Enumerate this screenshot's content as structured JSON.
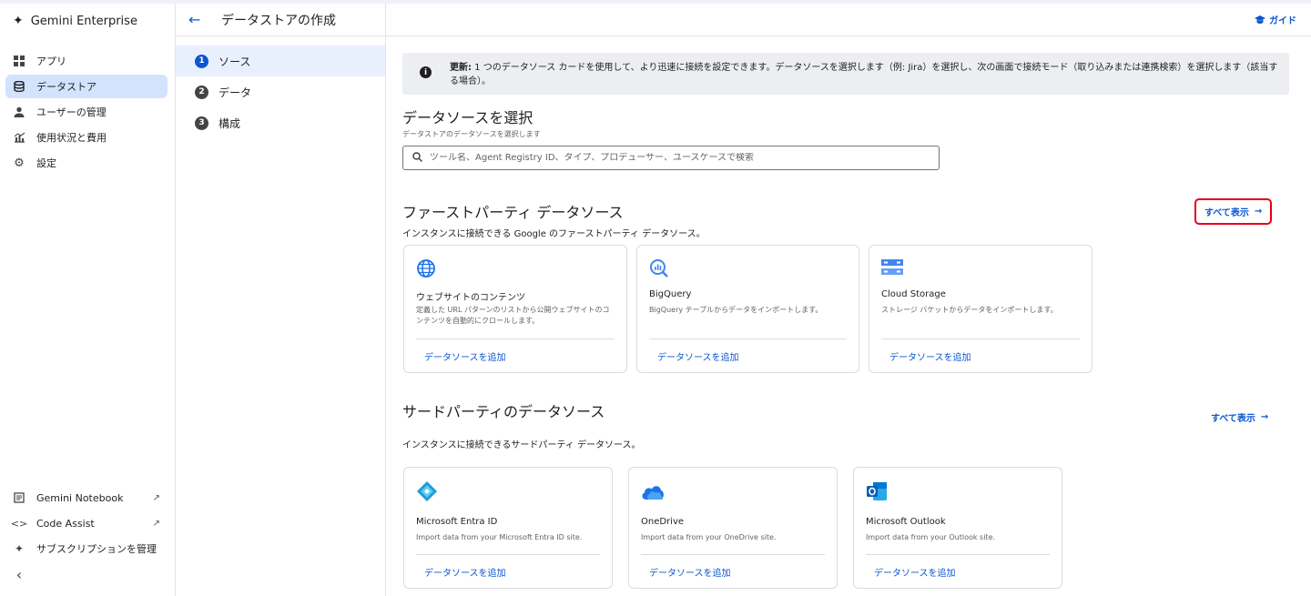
{
  "app": {
    "title": "Gemini Enterprise"
  },
  "sidebar": {
    "items": [
      {
        "label": "アプリ",
        "icon": "apps-grid-icon"
      },
      {
        "label": "データストア",
        "icon": "database-icon",
        "active": true
      },
      {
        "label": "ユーザーの管理",
        "icon": "person-icon"
      },
      {
        "label": "使用状況と費用",
        "icon": "analytics-icon"
      },
      {
        "label": "設定",
        "icon": "gear-icon"
      }
    ],
    "bottom": [
      {
        "label": "Gemini Notebook",
        "icon": "notebook-icon"
      },
      {
        "label": "Code Assist",
        "icon": "code-icon"
      },
      {
        "label": "サブスクリプションを管理",
        "icon": "sparkle-icon"
      }
    ],
    "collapse_label": "‹"
  },
  "header": {
    "title": "データストアの作成",
    "guide_label": "ガイド"
  },
  "steps": [
    {
      "num": "1",
      "label": "ソース",
      "active": true
    },
    {
      "num": "2",
      "label": "データ"
    },
    {
      "num": "3",
      "label": "構成"
    }
  ],
  "banner": {
    "bold": "更新:",
    "text": " 1 つのデータソース カードを使用して、より迅速に接続を設定できます。データソースを選択します（例: Jira）を選択し、次の画面で接続モード（取り込みまたは連携検索）を選択します（該当する場合）。"
  },
  "select": {
    "title": "データソースを選択",
    "subtitle": "データストアのデータソースを選択します",
    "search_placeholder": "ツール名、Agent Registry ID、タイプ、プロデューサー、ユースケースで検索"
  },
  "first_party": {
    "title": "ファーストパーティ データソース",
    "subtitle": "インスタンスに接続できる Google のファーストパーティ データソース。",
    "show_all": "すべて表示",
    "cards": [
      {
        "title": "ウェブサイトのコンテンツ",
        "desc": "定義した URL パターンのリストから公開ウェブサイトのコンテンツを自動的にクロールします。",
        "link": "データソースを追加",
        "icon": "globe-icon"
      },
      {
        "title": "BigQuery",
        "desc": "BigQuery テーブルからデータをインポートします。",
        "link": "データソースを追加",
        "icon": "bigquery-icon"
      },
      {
        "title": "Cloud Storage",
        "desc": "ストレージ バケットからデータをインポートします。",
        "link": "データソースを追加",
        "icon": "cloud-storage-icon"
      }
    ]
  },
  "third_party": {
    "title": "サードパーティのデータソース",
    "subtitle": "インスタンスに接続できるサードパーティ データソース。",
    "show_all": "すべて表示",
    "cards": [
      {
        "title": "Microsoft Entra ID",
        "desc": "Import data from your Microsoft Entra ID site.",
        "link": "データソースを追加",
        "icon": "entra-id-icon"
      },
      {
        "title": "OneDrive",
        "desc": "Import data from your OneDrive site.",
        "link": "データソースを追加",
        "icon": "onedrive-icon"
      },
      {
        "title": "Microsoft Outlook",
        "desc": "Import data from your Outlook site.",
        "link": "データソースを追加",
        "icon": "outlook-icon"
      }
    ]
  },
  "colors": {
    "accent": "#0b57d0",
    "active_nav": "#d3e3fd",
    "highlight_border": "#e3001b"
  }
}
